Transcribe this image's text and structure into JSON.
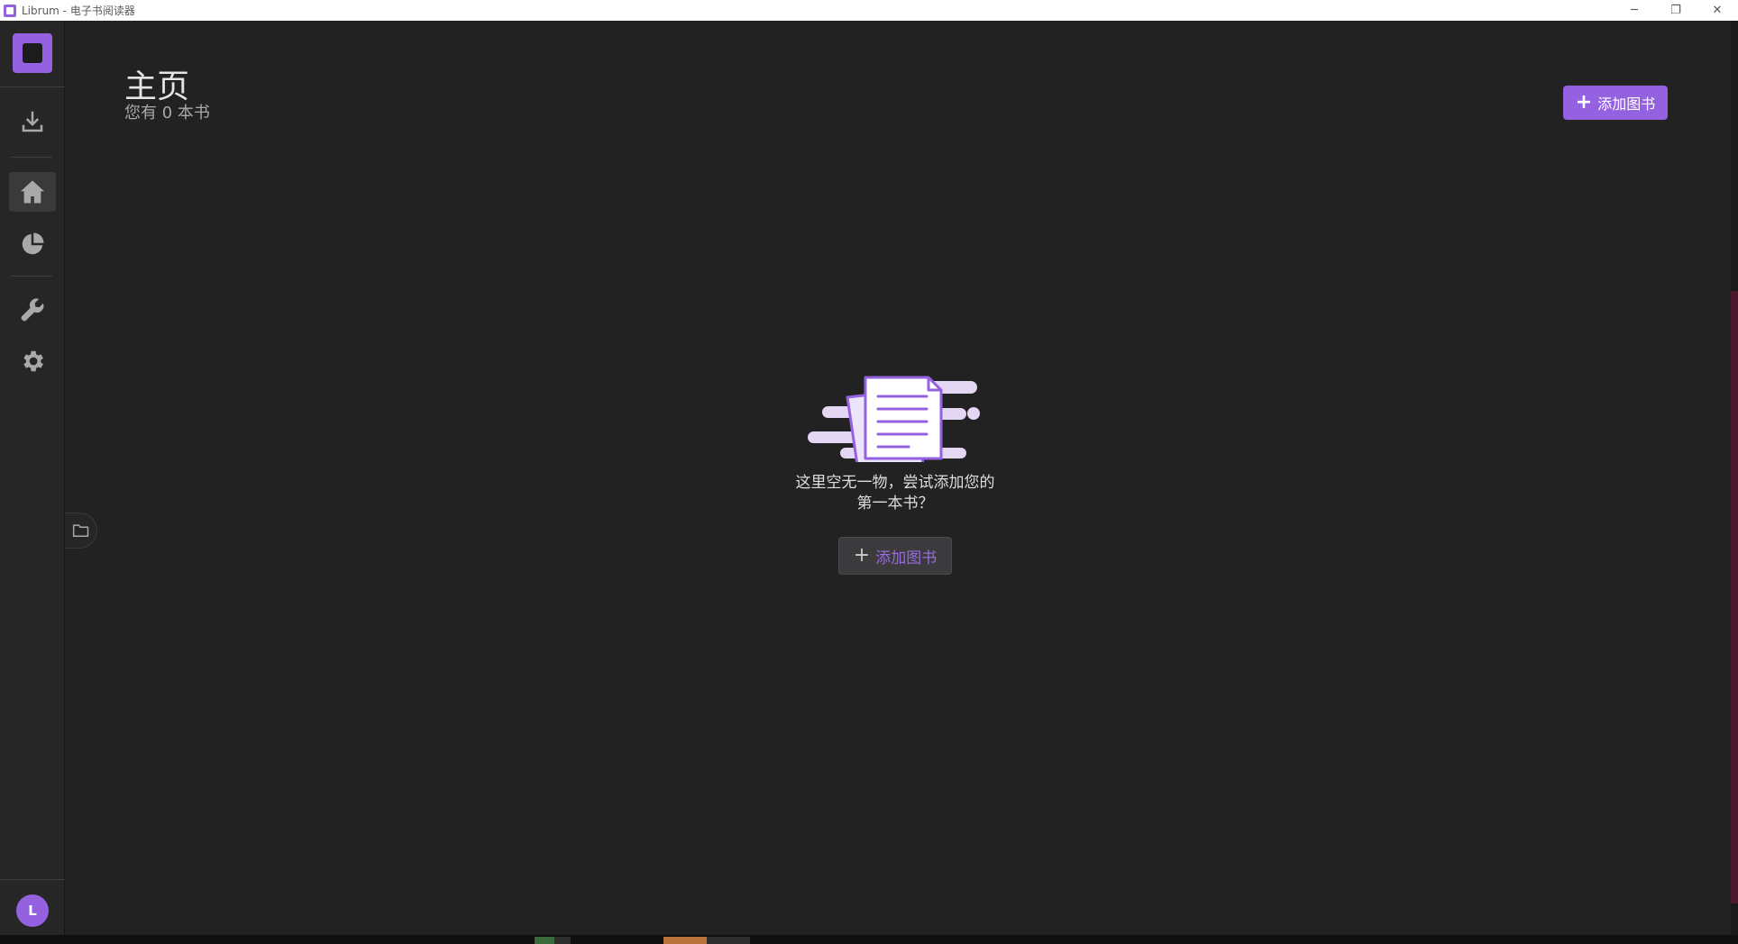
{
  "window": {
    "title": "Librum - 电子书阅读器",
    "controls": {
      "minimize": "─",
      "restore": "❐",
      "close": "✕"
    }
  },
  "sidebar": {
    "items": [
      {
        "name": "download",
        "icon": "download-icon"
      },
      {
        "name": "home",
        "icon": "home-icon",
        "active": true
      },
      {
        "name": "statistics",
        "icon": "pie-chart-icon"
      },
      {
        "name": "tools",
        "icon": "wrench-icon"
      },
      {
        "name": "settings",
        "icon": "gear-icon"
      }
    ],
    "avatar_initial": "L"
  },
  "header": {
    "title": "主页",
    "book_count": "您有 0 本书",
    "add_button": "添加图书"
  },
  "empty_state": {
    "line1": "这里空无一物，尝试添加您的",
    "line2": "第一本书？",
    "add_button": "添加图书"
  },
  "colors": {
    "accent": "#9462e0",
    "background": "#222222",
    "sidebar": "#262626"
  }
}
